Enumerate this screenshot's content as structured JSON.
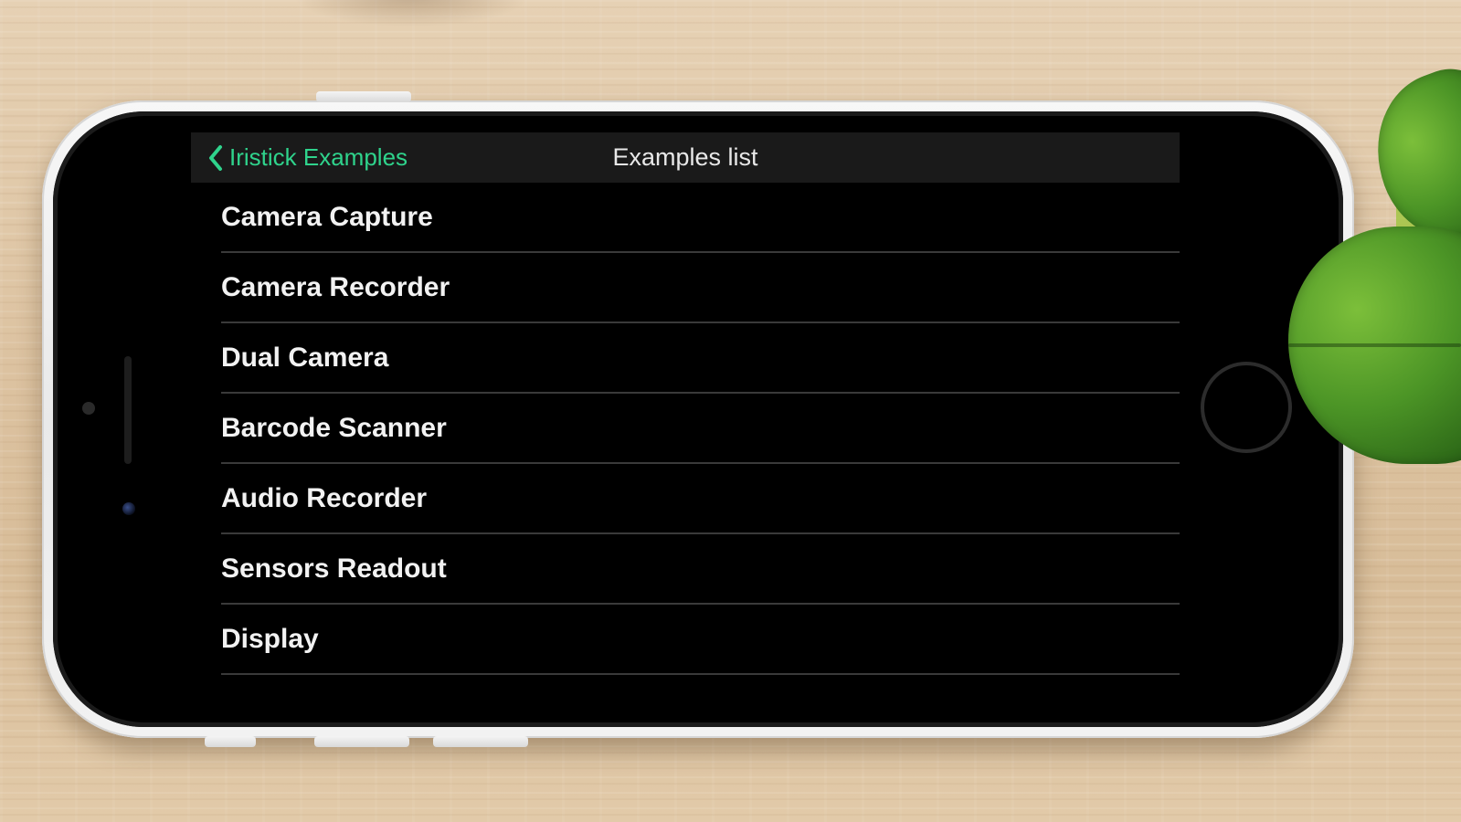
{
  "colors": {
    "accent": "#2fd38c",
    "nav_bar_bg": "#1a1a1a",
    "screen_bg": "#000000",
    "list_text": "#f2f2f2",
    "separator": "#3a3a3a"
  },
  "nav": {
    "back_label": "Iristick Examples",
    "back_icon": "chevron-left-icon",
    "title": "Examples list"
  },
  "list": {
    "items": [
      {
        "label": "Camera Capture"
      },
      {
        "label": "Camera Recorder"
      },
      {
        "label": "Dual Camera"
      },
      {
        "label": "Barcode Scanner"
      },
      {
        "label": "Audio Recorder"
      },
      {
        "label": "Sensors Readout"
      },
      {
        "label": "Display"
      }
    ]
  }
}
